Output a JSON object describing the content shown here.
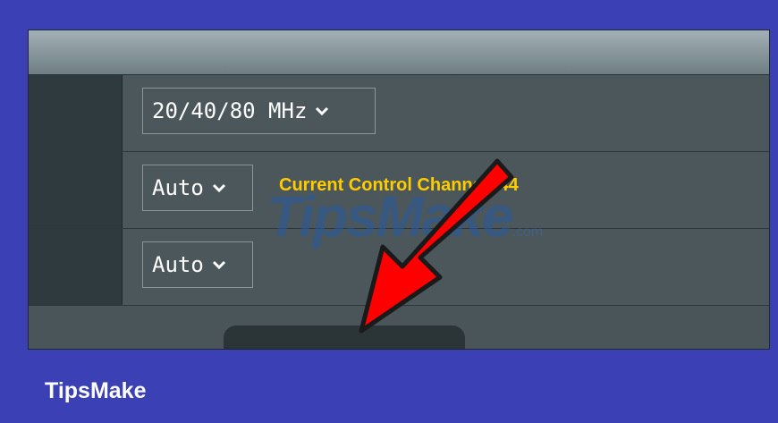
{
  "settings": {
    "bandwidth_select": {
      "value": "20/40/80 MHz"
    },
    "control_channel_select": {
      "value": "Auto"
    },
    "control_channel_status": "Current Control Channel: 44",
    "extension_channel_select": {
      "value": "Auto"
    }
  },
  "watermark": {
    "text": "TipsMake",
    "suffix": ".com"
  },
  "caption": {
    "text": "TipsMake"
  },
  "colors": {
    "frame_blue": "#3b40b5",
    "status_yellow": "#ffcc00",
    "arrow_red": "#ff0000"
  },
  "icons": [
    "chevron-down-icon",
    "red-arrow-pointer"
  ]
}
